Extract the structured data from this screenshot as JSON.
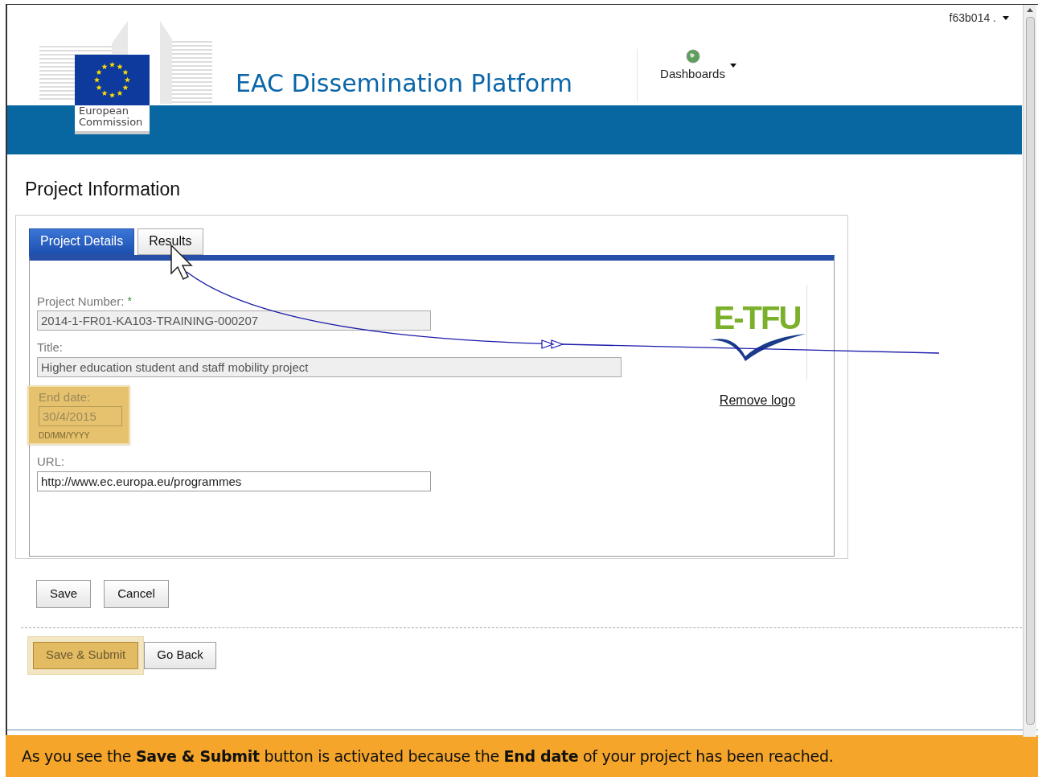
{
  "header": {
    "logo_caption": "European Commission",
    "site_title": "EAC Dissemination Platform",
    "nav": [
      {
        "label": "Dashboards"
      }
    ],
    "user_menu": "f63b014 ."
  },
  "page_heading": "Project Information",
  "tabs": [
    {
      "label": "Project Details",
      "selected": true
    },
    {
      "label": "Results",
      "selected": false
    }
  ],
  "fields": [
    {
      "label": "Project Number:",
      "required_mark": "*",
      "value": "2014-1-FR01-KA103-TRAINING-000207",
      "disabled": true,
      "highlighted": false
    },
    {
      "label": "Title:",
      "value": "Higher education student and staff mobility project",
      "disabled": true,
      "highlighted": false
    },
    {
      "label": "End date:",
      "value": "30/4/2015",
      "hint": "DD/MM/YYYY",
      "disabled": true,
      "highlighted": true
    },
    {
      "label": "URL:",
      "value": "http://www.ec.europa.eu/programmes",
      "disabled": false,
      "highlighted": false
    }
  ],
  "project_logo": {
    "text": "E-TFU",
    "remove_link": "Remove logo"
  },
  "form_buttons": [
    {
      "label": "Save"
    },
    {
      "label": "Cancel"
    }
  ],
  "footer_buttons": [
    {
      "label": "Save & Submit",
      "highlighted": true
    },
    {
      "label": "Go Back",
      "highlighted": false
    }
  ],
  "banner": "As you see the **Save & Submit** button is activated because the **End date** of your project has been reached."
}
